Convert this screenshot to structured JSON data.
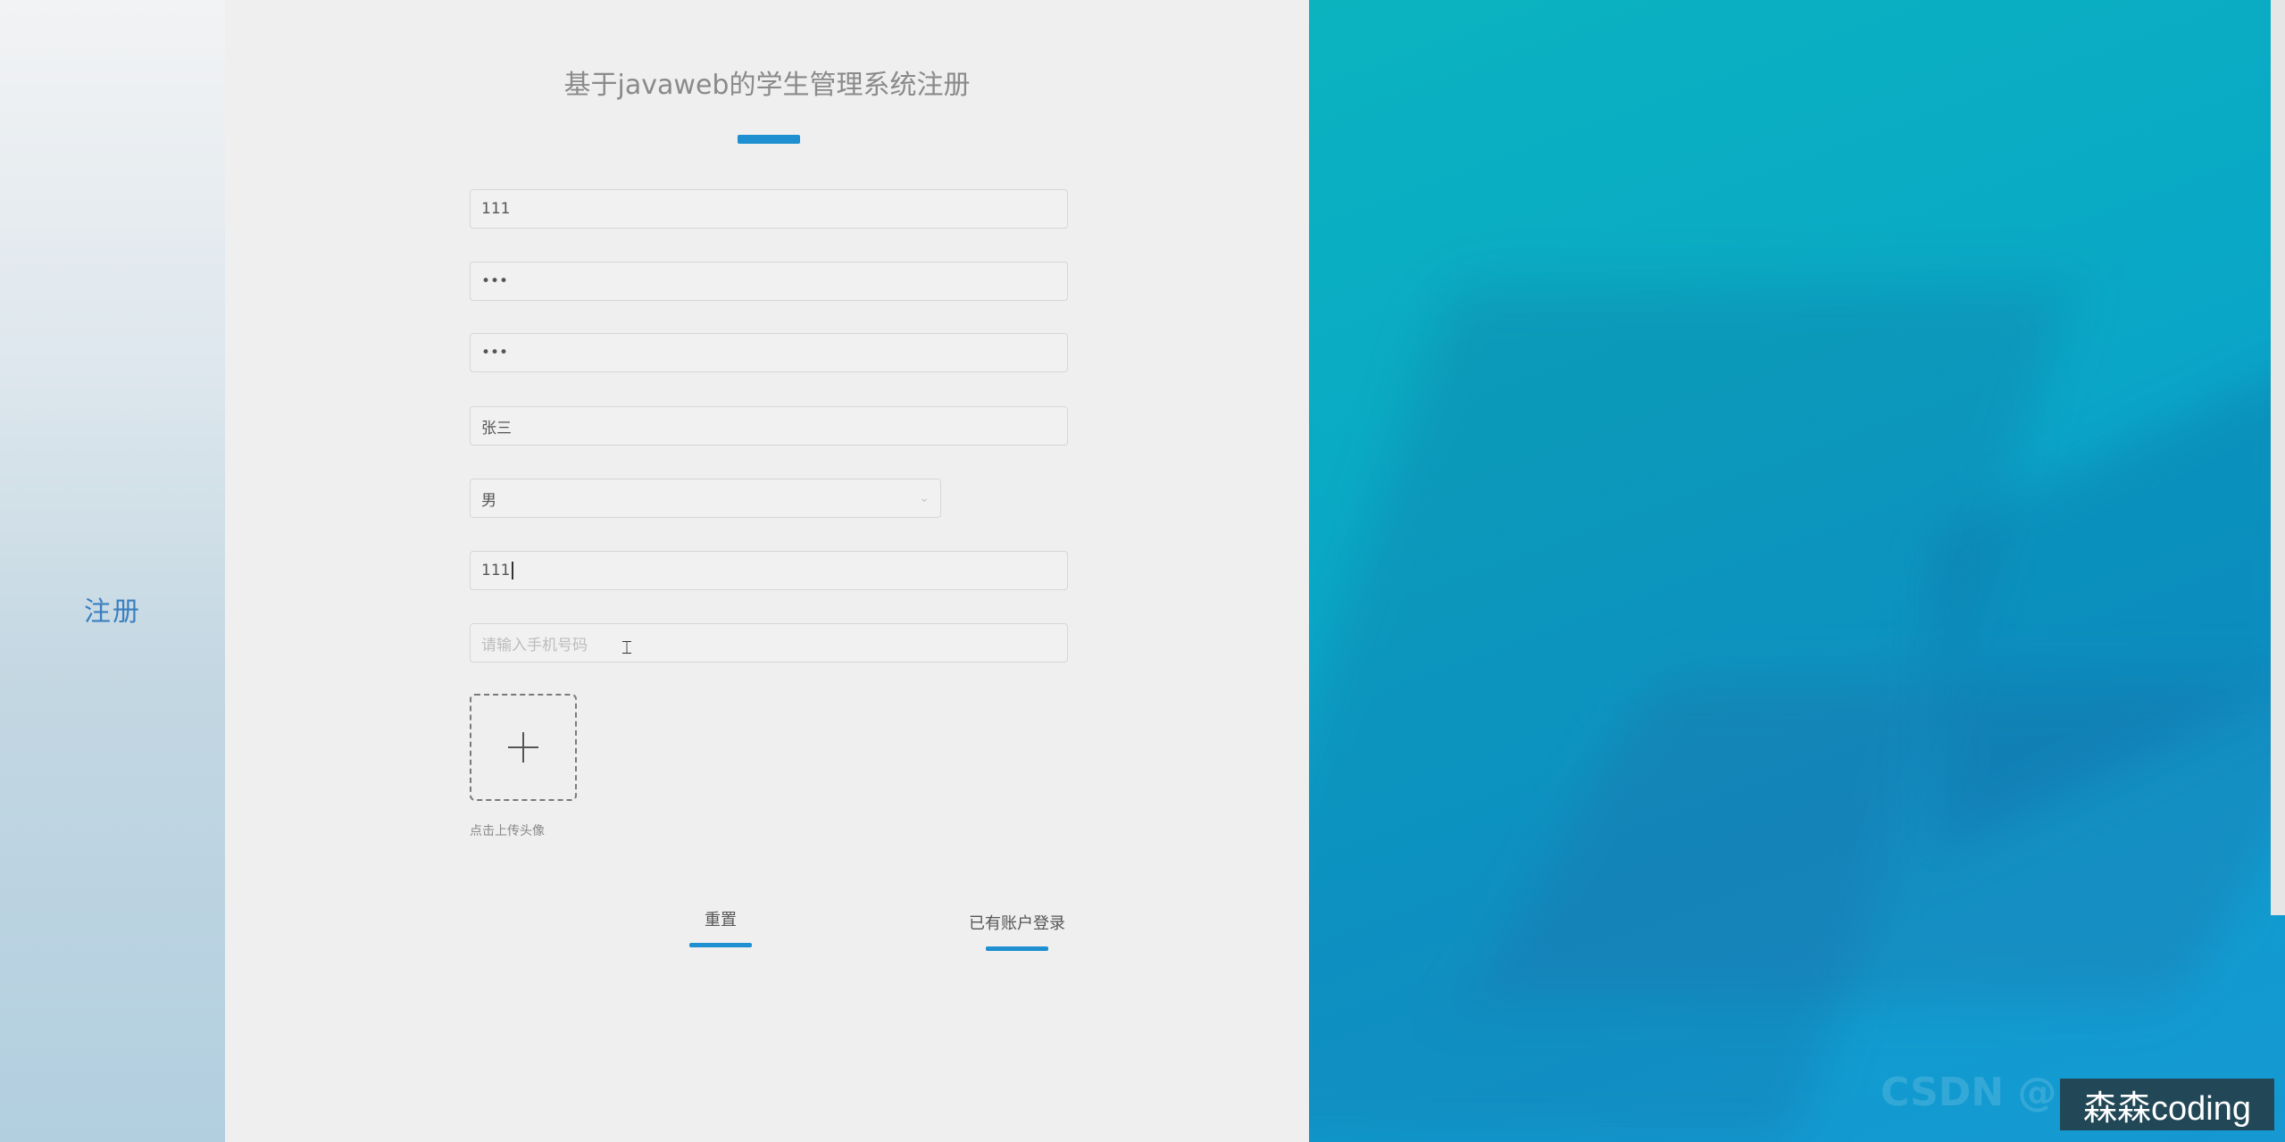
{
  "sidebar": {
    "label": "注册"
  },
  "form": {
    "title": "基于javaweb的学生管理系统注册",
    "fields": {
      "account": {
        "value": "111"
      },
      "password": {
        "value": "•••"
      },
      "confirm_password": {
        "value": "•••"
      },
      "name": {
        "value": "张三"
      },
      "gender": {
        "value": "男"
      },
      "age": {
        "value": "111"
      },
      "phone": {
        "placeholder": "请输入手机号码"
      }
    },
    "upload_hint": "点击上传头像",
    "reset_label": "重置",
    "login_link_label": "已有账户登录"
  },
  "overlay": {
    "faint_text": "CSDN @",
    "watermark": "森森coding"
  },
  "colors": {
    "accent": "#1e8fd0",
    "panel_bg": "#efefef",
    "image_teal": "#0bb3bf"
  }
}
